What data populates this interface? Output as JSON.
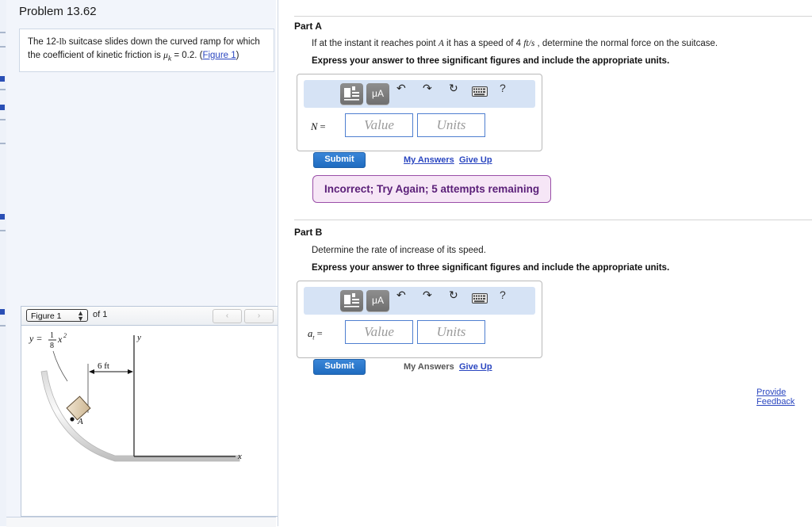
{
  "problem": {
    "title": "Problem 13.62",
    "statement_pre": "The 12-",
    "statement_unit": "lb",
    "statement_mid": " suitcase slides down the curved ramp for which the coefficient of kinetic friction is ",
    "mu_symbol": "μ",
    "mu_sub": "k",
    "statement_post": " = 0.2. (",
    "figure_link": "Figure 1",
    "statement_end": ")"
  },
  "figure_panel": {
    "selected_figure": "Figure 1",
    "of_label": "of 1",
    "prev_icon": "‹",
    "next_icon": "›",
    "caption_equation": "y = 1/8 x²",
    "dimension_label": "6 ft",
    "point_label": "A",
    "axis_x": "x",
    "axis_y": "y"
  },
  "parts": [
    {
      "heading": "Part A",
      "question_pre": "If at the instant it reaches point ",
      "question_var": "A",
      "question_mid": " it has a speed of 4 ",
      "question_unit": "ft/s",
      "question_post": " , determine the normal force on the suitcase.",
      "instruction": "Express your answer to three significant figures and include the appropriate units.",
      "answer_label": "N",
      "equals": "=",
      "value_placeholder": "Value",
      "units_placeholder": "Units",
      "submit_label": "Submit",
      "my_answers_label": "My Answers",
      "give_up_label": "Give Up",
      "my_answers_active": true,
      "alert": "Incorrect; Try Again; 5 attempts remaining"
    },
    {
      "heading": "Part B",
      "question_pre": "Determine the rate of increase of its speed.",
      "question_var": "",
      "question_mid": "",
      "question_unit": "",
      "question_post": "",
      "instruction": "Express your answer to three significant figures and include the appropriate units.",
      "answer_label": "a",
      "answer_label_sub": "t",
      "equals": "=",
      "value_placeholder": "Value",
      "units_placeholder": "Units",
      "submit_label": "Submit",
      "my_answers_label": "My Answers",
      "give_up_label": "Give Up",
      "my_answers_active": false,
      "alert": null
    }
  ],
  "toolbar": {
    "template_icon": "template-icon",
    "units_icon": "μA",
    "undo_icon": "↶",
    "redo_icon": "↷",
    "reset_icon": "↻",
    "keyboard_icon": "keyboard-icon",
    "help_icon": "?"
  },
  "feedback": {
    "label": "Provide Feedback"
  },
  "colors": {
    "accent_link": "#2a46c0",
    "submit_blue": "#1f6cc0",
    "alert_border": "#9a4fa8",
    "alert_bg": "#f6e6f6",
    "alert_text": "#5a1f78",
    "panel_bg": "#f2f5fb",
    "toolbar_bg": "#d6e3f5"
  }
}
